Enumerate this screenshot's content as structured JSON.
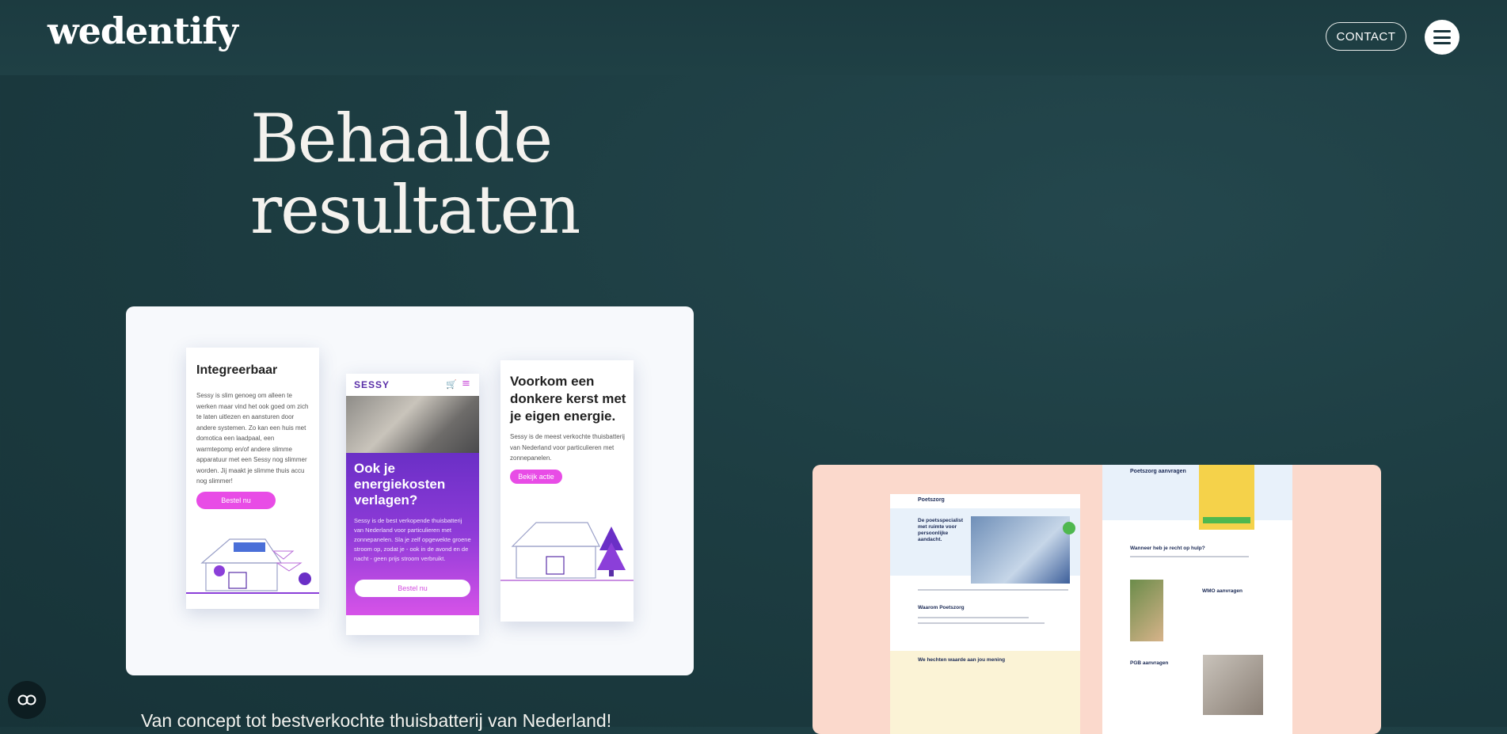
{
  "header": {
    "logo_text": "wedentify",
    "contact_label": "CONTACT",
    "menu_icon": "hamburger-icon"
  },
  "hero": {
    "title_line1": "Behaalde",
    "title_line2": "resultaten"
  },
  "projects": [
    {
      "name": "sessy",
      "caption": "Van concept tot bestverkochte thuisbatterij van Nederland!",
      "phones": [
        {
          "title": "Integreerbaar",
          "text": "Sessy is slim genoeg om alleen te werken maar vind het ook goed om zich te laten uitlezen en aansturen door andere systemen. Zo kan een huis met domotica een laadpaal, een warmtepomp en/of andere slimme apparatuur met een Sessy nog slimmer worden. Jij maakt je slimme thuis accu nog slimmer!",
          "button": "Bestel nu"
        },
        {
          "logo": "SESSY",
          "title": "Ook je energiekosten verlagen?",
          "text": "Sessy is de best verkopende thuisbatterij van Nederland voor particulieren met zonnepanelen. Sla je zelf opgewekte groene stroom op, zodat je - ook in de avond en de nacht - geen prijs stroom verbruikt.",
          "button": "Bestel nu"
        },
        {
          "title": "Voorkom een donkere kerst met je eigen energie.",
          "text": "Sessy is de meest verkochte thuisbatterij van Nederland voor particulieren met zonnepanelen.",
          "button": "Bekijk actie"
        }
      ]
    },
    {
      "name": "poetszorg",
      "screens": [
        {
          "logo": "Poetszorg",
          "headline": "De poetsspecialist met ruimte voor persoonlijke aandacht.",
          "section1": "Waarom Poetszorg",
          "section2": "We hechten waarde aan jou mening"
        },
        {
          "heading": "Poetszorg aanvragen",
          "section1": "Wanneer heb je recht op hulp?",
          "section2": "WMO aanvragen",
          "section3": "PGB aanvragen"
        }
      ]
    }
  ],
  "accessibility_icon": "accessibility-icon",
  "colors": {
    "background": "#1d3d42",
    "accent_pink": "#e84ce6",
    "accent_purple": "#6a2fc6",
    "card_peach": "#fbd9cc"
  }
}
